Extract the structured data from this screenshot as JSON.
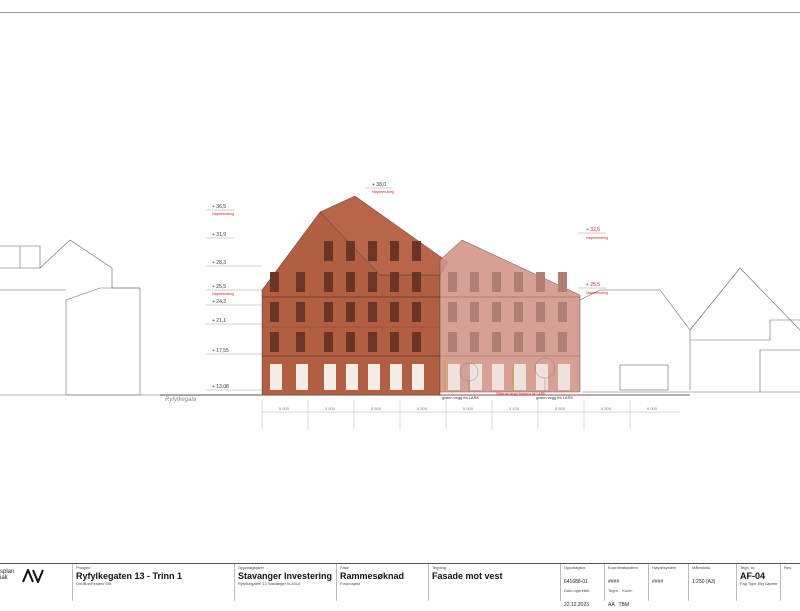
{
  "elevations": {
    "left": [
      {
        "label": "+ 36,5",
        "note": "Høydeendring"
      },
      {
        "label": "+ 31,9",
        "note": ""
      },
      {
        "label": "+ 28,3",
        "note": ""
      },
      {
        "label": "+ 25,5",
        "note": "Høydeendring"
      },
      {
        "label": "+ 24,3",
        "note": ""
      },
      {
        "label": "+ 21,1",
        "note": ""
      },
      {
        "label": "+ 17,55",
        "note": ""
      },
      {
        "label": "+ 13,08",
        "note": ""
      }
    ],
    "top": {
      "label": "+ 38,0",
      "note": "Høydeendring"
    },
    "right": [
      {
        "label": "+ 32,5",
        "note": "Høydeendring"
      },
      {
        "label": "+ 25,5",
        "note": "Høydeendring"
      }
    ]
  },
  "street_label": "Ryfylkegata",
  "annotations": {
    "green_wall_left": "grønn vegg iht LARK",
    "bench_note": "Sittbenk langs trappen iht LARK",
    "green_wall_right": "grønn vegg iht LARK"
  },
  "dimensions": [
    "5 600",
    "5 500",
    "5 500",
    "5 500",
    "5 500",
    "5 100",
    "5 500",
    "5 500",
    "6 000"
  ],
  "title_block": {
    "logo_line1": "splan",
    "logo_line2": "iak",
    "project_label": "Prosjekt",
    "project_name": "Ryfylkegaten 13 - Trinn 1",
    "project_sub": "Gnr/Bnr/Festenr 0/8",
    "client_label": "Oppdragsgiver",
    "client_name": "Stavanger Investering",
    "client_address": "Ryfylkegaten 13 Stavanger N-4014",
    "phase_label": "Fase",
    "phase": "Rammesøknad",
    "phase_sub": "Forprosjekt",
    "drawing_label": "Tegning",
    "drawing_title": "Fasade mot vest",
    "assignment_label": "Oppdragsnr.",
    "assignment_no": "641688-01",
    "date_label": "Dato opprettet",
    "date": "22.12.2023",
    "drawn_label": "Tegnr.",
    "drawn_by": "AA",
    "checked_label": "Kontr.",
    "checked_by": "TBM",
    "coord_label": "Koordinatsystem",
    "coord_value": "####",
    "height_label": "Høydesystem",
    "height_value": "####",
    "scale_label": "Målestokk",
    "scale": "1:250 (A3)",
    "sheet_label": "Tegn. nr.",
    "sheet_no": "AF-04",
    "sheet_sub": "Fag Type Etg   Løpenr",
    "rev_label": "Rev."
  },
  "colors": {
    "brick_dark": "#b15e42",
    "brick_mid": "#c0705a",
    "brick_light": "#d2968a",
    "window": "#6a3526",
    "red_text": "#d22020",
    "outline": "#444444"
  }
}
